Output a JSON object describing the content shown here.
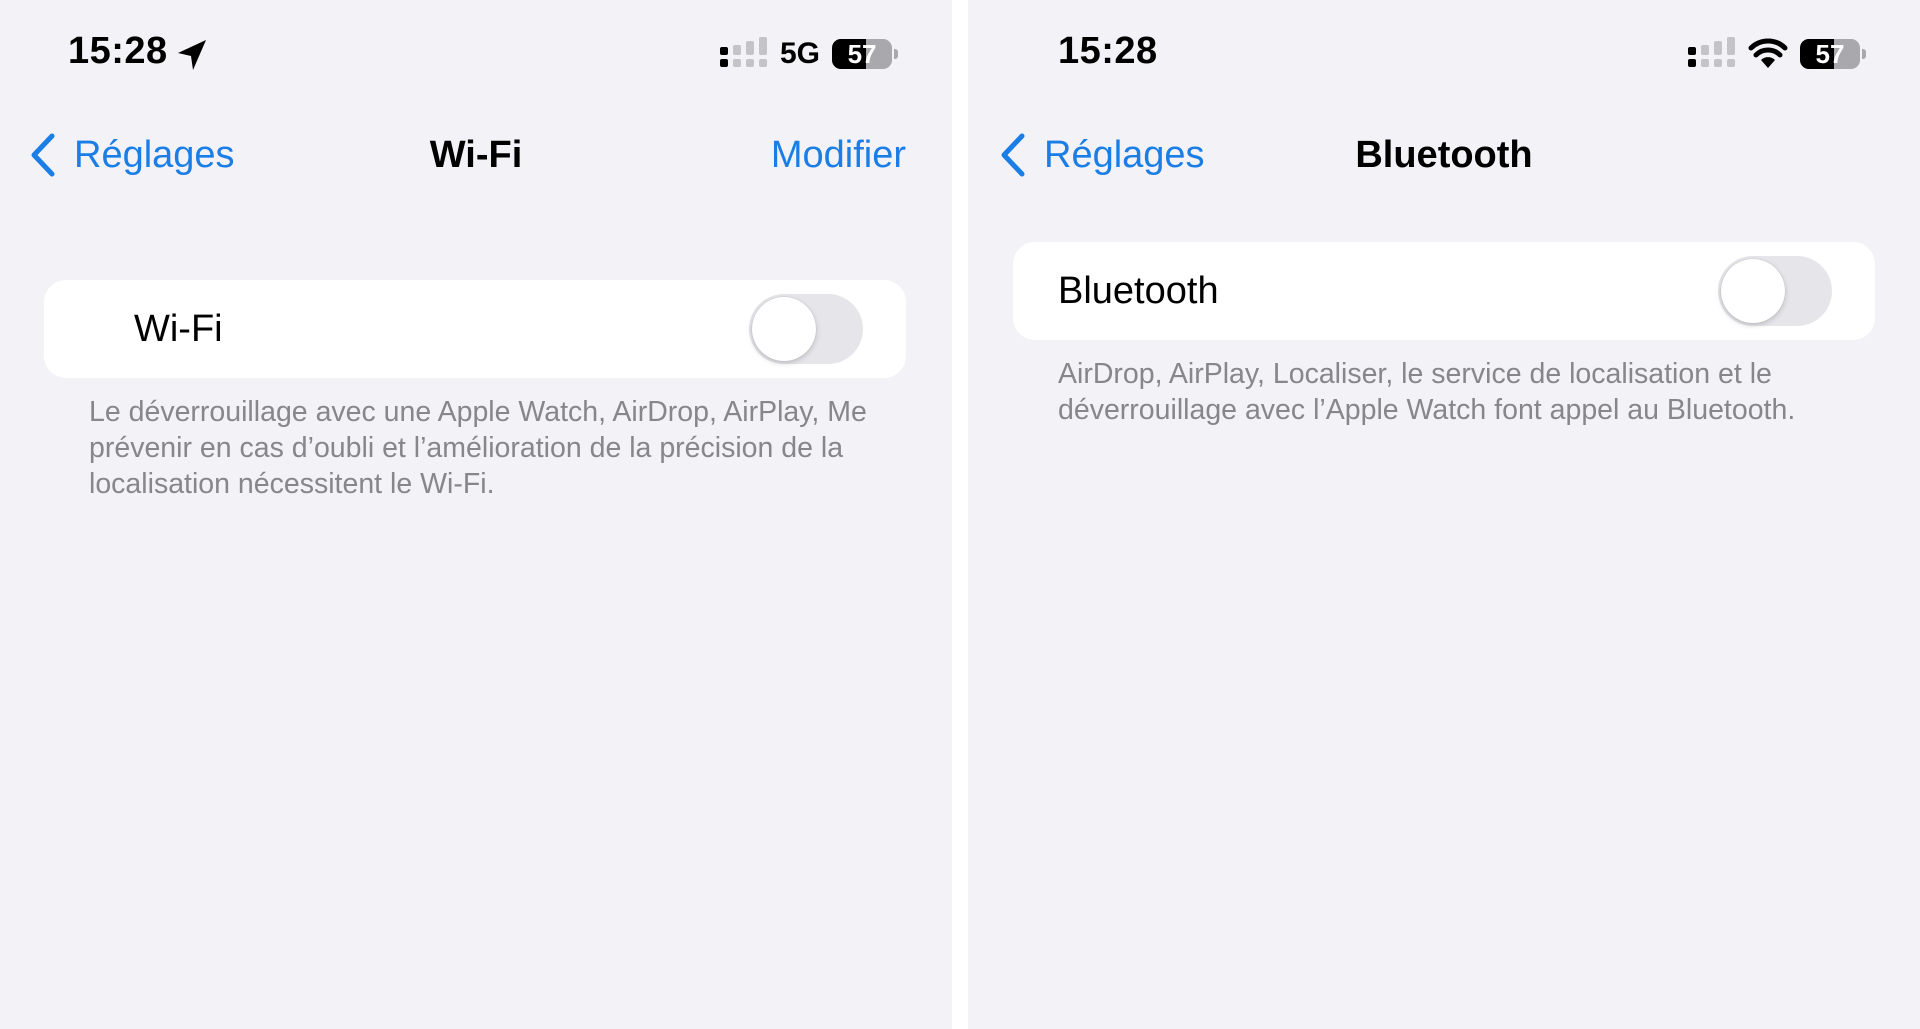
{
  "wifi_screen": {
    "status_bar": {
      "time": "15:28",
      "location_icon": "location-arrow-icon",
      "signal_icon": "cellular-signal-icon",
      "network_label": "5G",
      "battery_percent": "57",
      "battery_level": 0.57
    },
    "nav": {
      "back_label": "Réglages",
      "back_icon": "chevron-left-icon",
      "title": "Wi-Fi",
      "action_label": "Modifier"
    },
    "toggle_cell": {
      "label": "Wi-Fi",
      "enabled": false
    },
    "footer": "Le déverrouillage avec une Apple Watch, AirDrop, AirPlay, Me prévenir en cas d’oubli et l’amélioration de la précision de la localisation nécessitent le Wi-Fi."
  },
  "bluetooth_screen": {
    "status_bar": {
      "time": "15:28",
      "signal_icon": "cellular-signal-icon",
      "wifi_icon": "wifi-icon",
      "battery_percent": "57",
      "battery_level": 0.57
    },
    "nav": {
      "back_label": "Réglages",
      "back_icon": "chevron-left-icon",
      "title": "Bluetooth"
    },
    "toggle_cell": {
      "label": "Bluetooth",
      "enabled": false
    },
    "footer": "AirDrop, AirPlay, Localiser, le service de localisation et le déverrouillage avec l’Apple Watch font appel au Bluetooth."
  },
  "colors": {
    "accent": "#1a7ee6",
    "background": "#f2f2f7",
    "cell": "#ffffff",
    "footer_text": "#86868b",
    "toggle_off": "#e6e6ea"
  }
}
